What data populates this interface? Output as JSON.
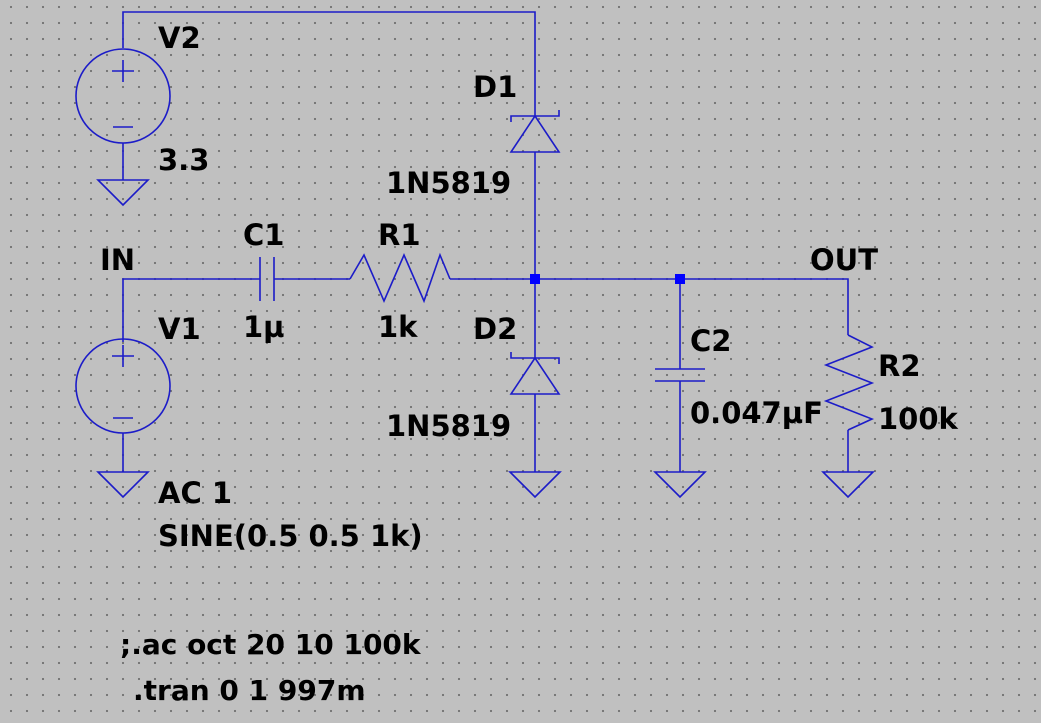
{
  "components": {
    "v2": {
      "ref": "V2",
      "value": "3.3"
    },
    "v1": {
      "ref": "V1",
      "value_lines": [
        "AC 1",
        "SINE(0.5 0.5 1k)"
      ]
    },
    "d1": {
      "ref": "D1",
      "model": "1N5819"
    },
    "d2": {
      "ref": "D2",
      "model": "1N5819"
    },
    "c1": {
      "ref": "C1",
      "value": "1µ"
    },
    "r1": {
      "ref": "R1",
      "value": "1k"
    },
    "c2": {
      "ref": "C2",
      "value": "0.047µF"
    },
    "r2": {
      "ref": "R2",
      "value": "100k"
    }
  },
  "nets": {
    "in": "IN",
    "out": "OUT"
  },
  "directives": [
    ";.ac oct 20 10 100k",
    ".tran 0 1 997m"
  ],
  "colors": {
    "wire": "#1c1cc8",
    "junction": "#0000ff",
    "background": "#c0c0c0"
  }
}
